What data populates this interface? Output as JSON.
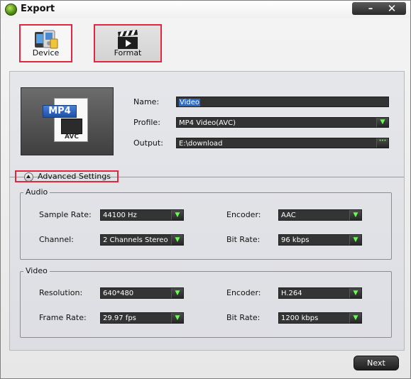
{
  "window": {
    "title": "Export",
    "minimize_label": "–",
    "close_label": "✕"
  },
  "tabs": [
    {
      "label": "Device",
      "icon": "device-icon"
    },
    {
      "label": "Format",
      "icon": "clapperboard-icon"
    }
  ],
  "preview": {
    "badge": "MP4",
    "subtitle": "AVC",
    "icon": "mp4-file-icon"
  },
  "form": {
    "name_label": "Name:",
    "name_value": "Video",
    "profile_label": "Profile:",
    "profile_value": "MP4 Video(AVC)",
    "output_label": "Output:",
    "output_value": "E:\\download",
    "browse_label": "···"
  },
  "advanced": {
    "label": "Advanced Settings"
  },
  "audio": {
    "title": "Audio",
    "sample_rate_label": "Sample Rate:",
    "sample_rate_value": "44100 Hz",
    "encoder_label": "Encoder:",
    "encoder_value": "AAC",
    "channel_label": "Channel:",
    "channel_value": "2 Channels Stereo",
    "bit_rate_label": "Bit Rate:",
    "bit_rate_value": "96 kbps"
  },
  "video": {
    "title": "Video",
    "resolution_label": "Resolution:",
    "resolution_value": "640*480",
    "encoder_label": "Encoder:",
    "encoder_value": "H.264",
    "frame_rate_label": "Frame Rate:",
    "frame_rate_value": "29.97 fps",
    "bit_rate_label": "Bit Rate:",
    "bit_rate_value": "1200 kbps"
  },
  "footer": {
    "next_label": "Next"
  },
  "colors": {
    "highlight_border": "#e0273f",
    "accent_green": "#66ff4f",
    "selection_blue": "#2a6ac9"
  }
}
